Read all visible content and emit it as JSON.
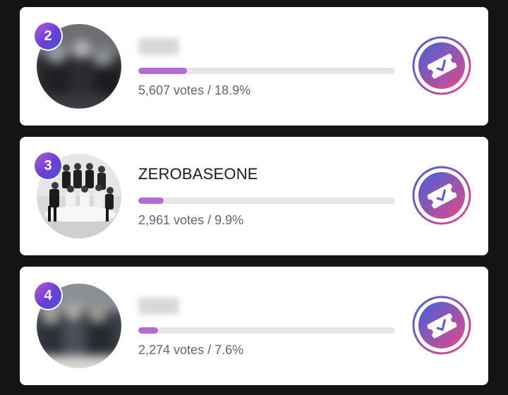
{
  "ranking": [
    {
      "rank": "2",
      "name": "",
      "name_hidden": true,
      "votes_text": "5,607 votes / 18.9%",
      "vote_share": 0.189,
      "avatar_blurred": true
    },
    {
      "rank": "3",
      "name": "ZEROBASEONE",
      "name_hidden": false,
      "votes_text": "2,961 votes / 9.9%",
      "vote_share": 0.099,
      "avatar_blurred": false
    },
    {
      "rank": "4",
      "name": "",
      "name_hidden": true,
      "votes_text": "2,274 votes / 7.6%",
      "vote_share": 0.076,
      "avatar_blurred": true
    }
  ],
  "icons": {
    "vote": "vote-ticket-check-icon"
  },
  "colors": {
    "background": "#141414",
    "card": "#ffffff",
    "progress_fill": "#b26ad6",
    "progress_track": "#e6e6e6",
    "rank_badge_from": "#b45ad8",
    "rank_badge_to": "#4655d8",
    "vote_gradient_from": "#4660d8",
    "vote_gradient_to": "#e24a8a"
  }
}
